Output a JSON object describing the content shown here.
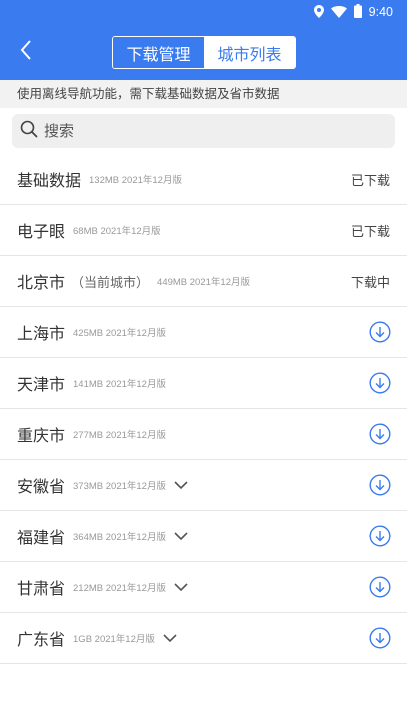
{
  "status_bar": {
    "time": "9:40"
  },
  "app_bar": {
    "tabs": [
      {
        "label": "下载管理",
        "active": false
      },
      {
        "label": "城市列表",
        "active": true
      }
    ]
  },
  "notice": "使用离线导航功能，需下载基础数据及省市数据",
  "search": {
    "placeholder": "搜索"
  },
  "colors": {
    "primary": "#3a7bf0",
    "download_icon": "#3a7bf0"
  },
  "cities": [
    {
      "name": "基础数据",
      "note": "",
      "meta": "132MB 2021年12月版",
      "status": "已下载",
      "expandable": false,
      "download": false
    },
    {
      "name": "电子眼",
      "note": "",
      "meta": "68MB 2021年12月版",
      "status": "已下载",
      "expandable": false,
      "download": false
    },
    {
      "name": "北京市",
      "note": "（当前城市）",
      "meta": "449MB 2021年12月版",
      "status": "下载中",
      "expandable": false,
      "download": false
    },
    {
      "name": "上海市",
      "note": "",
      "meta": "425MB 2021年12月版",
      "status": "",
      "expandable": false,
      "download": true
    },
    {
      "name": "天津市",
      "note": "",
      "meta": "141MB 2021年12月版",
      "status": "",
      "expandable": false,
      "download": true
    },
    {
      "name": "重庆市",
      "note": "",
      "meta": "277MB 2021年12月版",
      "status": "",
      "expandable": false,
      "download": true
    },
    {
      "name": "安徽省",
      "note": "",
      "meta": "373MB 2021年12月版",
      "status": "",
      "expandable": true,
      "download": true
    },
    {
      "name": "福建省",
      "note": "",
      "meta": "364MB 2021年12月版",
      "status": "",
      "expandable": true,
      "download": true
    },
    {
      "name": "甘肃省",
      "note": "",
      "meta": "212MB 2021年12月版",
      "status": "",
      "expandable": true,
      "download": true
    },
    {
      "name": "广东省",
      "note": "",
      "meta": "1GB 2021年12月版",
      "status": "",
      "expandable": true,
      "download": true
    }
  ]
}
